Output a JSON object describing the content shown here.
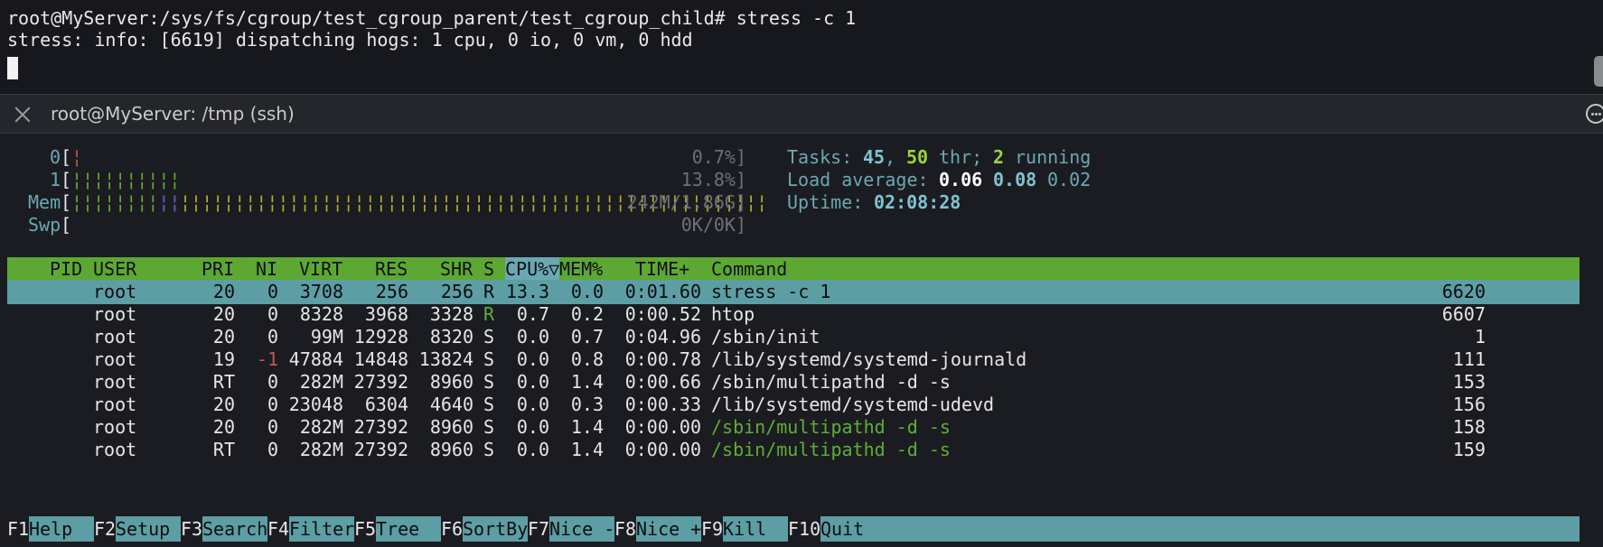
{
  "terminal": {
    "command_line": "root@MyServer:/sys/fs/cgroup/test_cgroup_parent/test_cgroup_child# stress -c 1",
    "output_line": "stress: info: [6619] dispatching hogs: 1 cpu, 0 io, 0 vm, 0 hdd"
  },
  "tab": {
    "title": "root@MyServer: /tmp (ssh)"
  },
  "meters": {
    "cpu0": {
      "label": "0",
      "value": "0.7%]",
      "bars": "¦"
    },
    "cpu1": {
      "label": "1",
      "value": "13.8%]",
      "bars": "¦¦¦¦¦¦¦¦¦¦"
    },
    "mem": {
      "label": "Mem",
      "value": "242M/1.86G]",
      "bars_green": "¦¦¦¦¦¦¦¦¦¦",
      "bars_blue": "¦¦",
      "bars_yellow": "¦¦¦¦¦¦¦¦¦¦¦¦¦¦¦¦¦¦¦¦¦¦¦¦¦¦¦¦¦¦¦¦¦¦¦¦¦¦¦¦¦¦¦¦¦¦¦¦¦¦¦¦¦¦"
    },
    "swp": {
      "label": "Swp",
      "value": "0K/0K]"
    },
    "open_bracket": "[",
    "color_bars": {
      "low": "#c35a4c",
      "normal": "#5fae35",
      "kernel": "#5b48c6",
      "cache": "#b6ac2e"
    }
  },
  "stats": {
    "tasks_label": "Tasks:",
    "tasks_count": "45",
    "tasks_sep": ",",
    "threads": "50",
    "threads_label": "thr;",
    "running": "2",
    "running_label": "running",
    "load_label": "Load average:",
    "load1": "0.06",
    "load5": "0.08",
    "load15": "0.02",
    "uptime_label": "Uptime:",
    "uptime": "02:08:28"
  },
  "table": {
    "columns": [
      "PID",
      "USER",
      "PRI",
      "NI",
      "VIRT",
      "RES",
      "SHR",
      "S",
      "CPU%▽",
      "MEM%",
      "TIME+",
      "Command"
    ],
    "rows": [
      {
        "pid": "6620",
        "user": "root",
        "pri": "20",
        "ni": "0",
        "virt": "3708",
        "res": "256",
        "shr": "256",
        "s": "R",
        "cpu": "13.3",
        "mem": "0.0",
        "time": "0:01.60",
        "cmd": "stress -c 1",
        "selected": true
      },
      {
        "pid": "6607",
        "user": "root",
        "pri": "20",
        "ni": "0",
        "virt": "8328",
        "res": "3968",
        "shr": "3328",
        "s": "R",
        "cpu": "0.7",
        "mem": "0.2",
        "time": "0:00.52",
        "cmd": "htop"
      },
      {
        "pid": "1",
        "user": "root",
        "pri": "20",
        "ni": "0",
        "virt": "99M",
        "res": "12928",
        "shr": "8320",
        "s": "S",
        "cpu": "0.0",
        "mem": "0.7",
        "time": "0:04.96",
        "cmd": "/sbin/init"
      },
      {
        "pid": "111",
        "user": "root",
        "pri": "19",
        "ni": "-1",
        "virt": "47884",
        "res": "14848",
        "shr": "13824",
        "s": "S",
        "cpu": "0.0",
        "mem": "0.8",
        "time": "0:00.78",
        "cmd": "/lib/systemd/systemd-journald"
      },
      {
        "pid": "153",
        "user": "root",
        "pri": "RT",
        "ni": "0",
        "virt": "282M",
        "res": "27392",
        "shr": "8960",
        "s": "S",
        "cpu": "0.0",
        "mem": "1.4",
        "time": "0:00.66",
        "cmd": "/sbin/multipathd -d -s"
      },
      {
        "pid": "156",
        "user": "root",
        "pri": "20",
        "ni": "0",
        "virt": "23048",
        "res": "6304",
        "shr": "4640",
        "s": "S",
        "cpu": "0.0",
        "mem": "0.3",
        "time": "0:00.33",
        "cmd": "/lib/systemd/systemd-udevd"
      },
      {
        "pid": "158",
        "user": "root",
        "pri": "20",
        "ni": "0",
        "virt": "282M",
        "res": "27392",
        "shr": "8960",
        "s": "S",
        "cpu": "0.0",
        "mem": "1.4",
        "time": "0:00.00",
        "cmd": "/sbin/multipathd -d -s",
        "thread": true
      },
      {
        "pid": "159",
        "user": "root",
        "pri": "RT",
        "ni": "0",
        "virt": "282M",
        "res": "27392",
        "shr": "8960",
        "s": "S",
        "cpu": "0.0",
        "mem": "1.4",
        "time": "0:00.00",
        "cmd": "/sbin/multipathd -d -s",
        "thread": true
      }
    ]
  },
  "fkeys": [
    {
      "key": "F1",
      "label": "Help  "
    },
    {
      "key": "F2",
      "label": "Setup "
    },
    {
      "key": "F3",
      "label": "Search"
    },
    {
      "key": "F4",
      "label": "Filter"
    },
    {
      "key": "F5",
      "label": "Tree  "
    },
    {
      "key": "F6",
      "label": "SortBy"
    },
    {
      "key": "F7",
      "label": "Nice -"
    },
    {
      "key": "F8",
      "label": "Nice +"
    },
    {
      "key": "F9",
      "label": "Kill  "
    },
    {
      "key": "F10",
      "label": "Quit"
    }
  ],
  "icons": {
    "close": "close-icon",
    "more": "more-options-icon"
  }
}
